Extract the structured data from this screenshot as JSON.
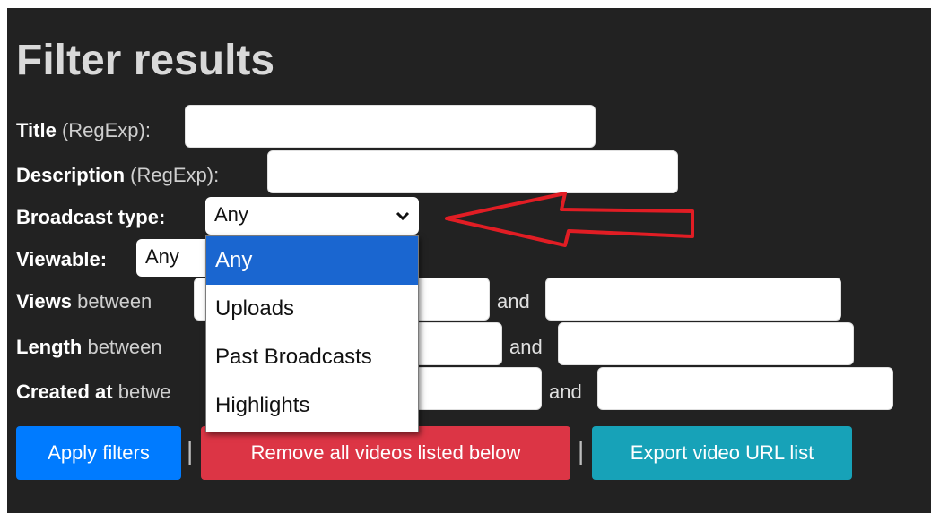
{
  "heading": "Filter results",
  "title_filter": {
    "label": "Title",
    "hint": "(RegExp):",
    "value": ""
  },
  "description_filter": {
    "label": "Description",
    "hint": "(RegExp):",
    "value": ""
  },
  "broadcast_type": {
    "label": "Broadcast type:",
    "selected": "Any",
    "options": [
      "Any",
      "Uploads",
      "Past Broadcasts",
      "Highlights"
    ],
    "highlighted_index": 0
  },
  "viewable": {
    "label": "Viewable:",
    "selected": "Any"
  },
  "views": {
    "label": "Views",
    "between": "between",
    "and": "and"
  },
  "length": {
    "label": "Length",
    "between": "between",
    "and": "and"
  },
  "created_at": {
    "label": "Created at",
    "between": "betwe",
    "and": "and"
  },
  "buttons": {
    "apply": "Apply filters",
    "remove": "Remove all videos listed below",
    "export": "Export video URL list",
    "separator": "|"
  },
  "colors": {
    "background": "#222222",
    "apply": "#007bff",
    "remove": "#dc3545",
    "export": "#17a2b8",
    "annotation_arrow": "#e11d24",
    "option_highlight": "#1a66d0"
  }
}
